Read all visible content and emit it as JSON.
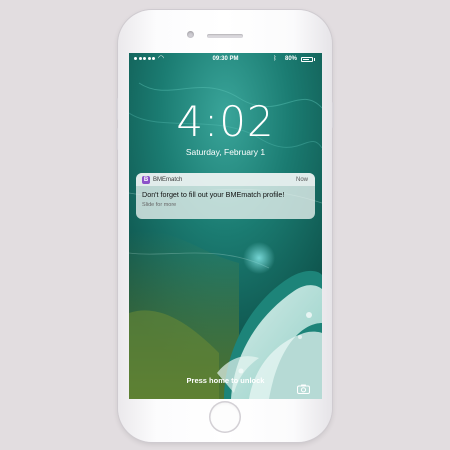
{
  "status_bar": {
    "time": "09:30 PM",
    "battery_percent": "80%",
    "battery_level": 0.8
  },
  "lock_screen": {
    "clock": "4:02",
    "date": "Saturday, February 1",
    "unlock_hint": "Press home to unlock"
  },
  "notification": {
    "app_icon_letter": "B",
    "app_name": "BMEmatch",
    "time": "Now",
    "message": "Don't forget to fill out your BMEmatch profile!",
    "subtext": "Slide for more"
  },
  "icons": {
    "signal": "signal-dots-icon",
    "wifi": "wifi-icon",
    "bluetooth": "bluetooth-icon",
    "battery": "battery-icon",
    "camera": "camera-icon"
  },
  "colors": {
    "app_icon": "#8b52c9",
    "page_background": "#e2dde0",
    "phone_body": "#ffffff"
  }
}
